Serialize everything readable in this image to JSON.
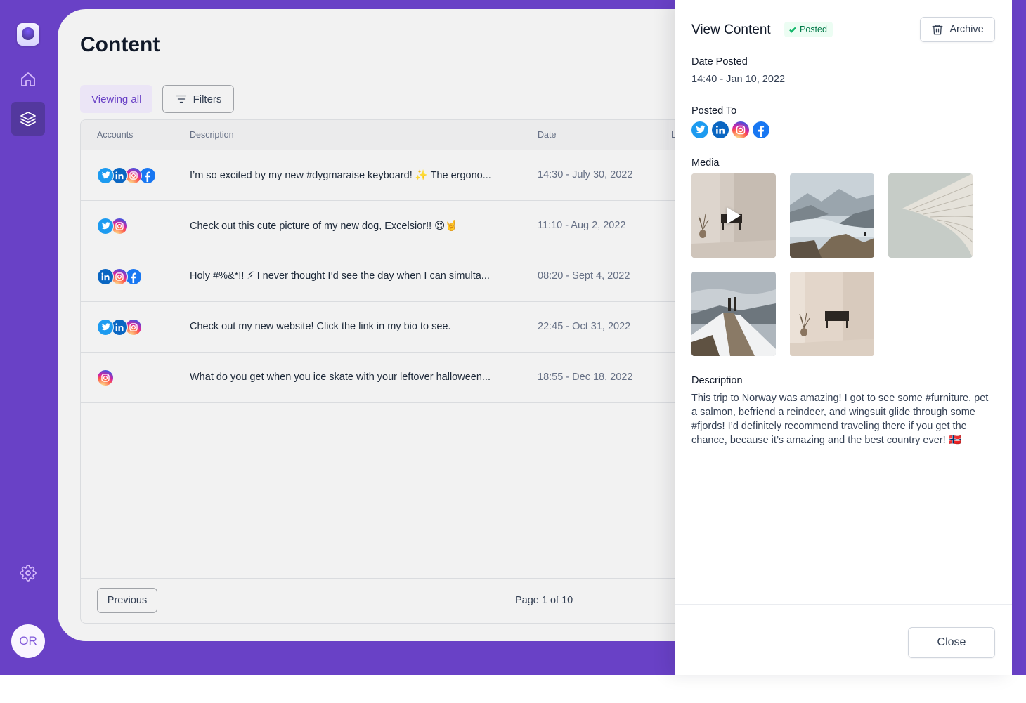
{
  "sidebar": {
    "items": [
      {
        "name": "home",
        "icon": "home-icon",
        "active": false
      },
      {
        "name": "content",
        "icon": "layers-icon",
        "active": true
      }
    ],
    "settings_icon": "gear-icon",
    "avatar_initials": "OR"
  },
  "main": {
    "title": "Content",
    "viewing_all_label": "Viewing all",
    "filters_label": "Filters",
    "table": {
      "headers": [
        "Accounts",
        "Description",
        "Date",
        "L"
      ],
      "rows": [
        {
          "accounts": [
            "twitter",
            "linkedin",
            "instagram",
            "facebook"
          ],
          "description": "I’m so excited by my new #dygmaraise keyboard! ✨ The ergono...",
          "date": "14:30 - July 30, 2022"
        },
        {
          "accounts": [
            "twitter",
            "instagram"
          ],
          "description": "Check out this cute picture of my new dog, Excelsior!! 😍🤘",
          "date": "11:10 - Aug 2, 2022"
        },
        {
          "accounts": [
            "linkedin",
            "instagram",
            "facebook"
          ],
          "description": "Holy #%&*!! ⚡ I never thought I’d see the day when I can simulta...",
          "date": "08:20 - Sept 4, 2022"
        },
        {
          "accounts": [
            "twitter",
            "linkedin",
            "instagram"
          ],
          "description": "Check out my new website! Click the link in my bio to see.",
          "date": "22:45 - Oct 31, 2022"
        },
        {
          "accounts": [
            "instagram"
          ],
          "description": "What do you get when you ice skate with your leftover halloween...",
          "date": "18:55 - Dec 18, 2022"
        }
      ]
    },
    "pagination": {
      "previous_label": "Previous",
      "page_label": "Page 1 of 10"
    }
  },
  "drawer": {
    "title": "View Content",
    "status_badge": "Posted",
    "archive_label": "Archive",
    "date_posted_label": "Date Posted",
    "date_posted_value": "14:40 - Jan 10, 2022",
    "posted_to_label": "Posted To",
    "posted_to": [
      "twitter",
      "linkedin",
      "instagram",
      "facebook"
    ],
    "media_label": "Media",
    "media": [
      {
        "kind": "video",
        "subject": "interior-room"
      },
      {
        "kind": "image",
        "subject": "fjord-mountains"
      },
      {
        "kind": "image",
        "subject": "architecture-curve"
      },
      {
        "kind": "image",
        "subject": "snowy-peak-hikers"
      },
      {
        "kind": "image",
        "subject": "interior-room"
      }
    ],
    "description_label": "Description",
    "description_text": "This trip to Norway was amazing! I got to see some #furniture, pet a salmon, befriend a reindeer, and wingsuit glide through some #fjords! I’d definitely recommend traveling there if you get the chance, because it’s amazing and the best country ever! 🇳🇴",
    "close_label": "Close"
  },
  "colors": {
    "brand": "#6941c6",
    "sidebar_active": "#53389e",
    "success": "#12b76a"
  }
}
